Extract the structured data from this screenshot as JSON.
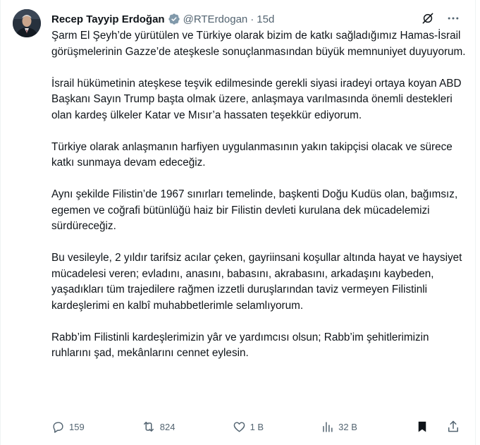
{
  "author": {
    "name": "Recep Tayyip Erdoğan",
    "handle": "@RTErdogan",
    "separator": "·",
    "time": "15d"
  },
  "body": {
    "p1": "Şarm El Şeyh’de yürütülen ve Türkiye olarak bizim de katkı sağladığımız Hamas-İsrail görüşmelerinin Gazze’de ateşkesle sonuçlanmasından büyük memnuniyet duyuyorum.",
    "p2": "İsrail hükümetinin ateşkese teşvik edilmesinde gerekli siyasi iradeyi ortaya koyan ABD Başkanı Sayın Trump başta olmak üzere, anlaşmaya varılmasında önemli destekleri olan kardeş ülkeler Katar ve Mısır’a hassaten teşekkür ediyorum.",
    "p3": "Türkiye olarak anlaşmanın harfiyen uygulanmasının yakın takipçisi olacak ve sürece katkı sunmaya devam edeceğiz.",
    "p4": "Aynı şekilde Filistin’de 1967 sınırları temelinde, başkenti Doğu Kudüs olan, bağımsız, egemen ve coğrafi bütünlüğü haiz bir Filistin devleti kurulana dek mücadelemizi sürdüreceğiz.",
    "p5": "Bu vesileyle, 2 yıldır tarifsiz acılar çeken, gayriinsani koşullar altında hayat ve haysiyet mücadelesi veren; evladını, anasını, babasını, akrabasını, arkadaşını kaybeden, yaşadıkları tüm trajedilere rağmen izzetli duruşlarından taviz vermeyen Filistinli kardeşlerimi en kalbî muhabbetlerimle selamlıyorum.",
    "p6": "Rabb’im Filistinli kardeşlerimizin yâr ve yardımcısı olsun; Rabb’im şehitlerimizin ruhlarını şad, mekânlarını cennet eylesin."
  },
  "actions": {
    "replies": "159",
    "reposts": "824",
    "likes": "1 B",
    "views": "32 B"
  },
  "icons": {
    "verified": "verified-badge-icon",
    "grok": "grok-icon",
    "more": "more-icon",
    "reply": "reply-icon",
    "repost": "repost-icon",
    "like": "heart-icon",
    "views": "views-icon",
    "bookmark": "bookmark-icon",
    "share": "share-icon"
  },
  "colors": {
    "text": "#0f1419",
    "secondary": "#536471",
    "verified": "#829aab"
  }
}
